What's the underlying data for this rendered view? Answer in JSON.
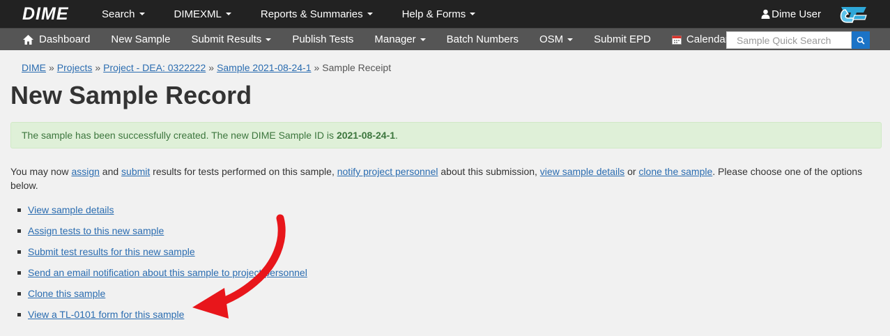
{
  "topbar": {
    "brand": "DIME",
    "nav": [
      {
        "label": "Search",
        "dropdown": true
      },
      {
        "label": "DIMEXML",
        "dropdown": true
      },
      {
        "label": "Reports & Summaries",
        "dropdown": true
      },
      {
        "label": "Help & Forms",
        "dropdown": true
      }
    ],
    "user": "Dime User"
  },
  "subbar": {
    "items": [
      {
        "label": "Dashboard",
        "icon": "home-icon"
      },
      {
        "label": "New Sample"
      },
      {
        "label": "Submit Results",
        "dropdown": true
      },
      {
        "label": "Publish Tests"
      },
      {
        "label": "Manager",
        "dropdown": true
      },
      {
        "label": "Batch Numbers"
      },
      {
        "label": "OSM",
        "dropdown": true
      },
      {
        "label": "Submit EPD"
      },
      {
        "label": "Calendar",
        "icon": "calendar-icon"
      }
    ],
    "search_placeholder": "Sample Quick Search"
  },
  "breadcrumb": {
    "items": [
      "DIME",
      "Projects",
      "Project - DEA: 0322222",
      "Sample 2021-08-24-1"
    ],
    "current": "Sample Receipt",
    "separator": "»"
  },
  "page_title": "New Sample Record",
  "alert": {
    "text": "The sample has been successfully created. The new DIME Sample ID is",
    "sample_id": "2021-08-24-1",
    "end": "."
  },
  "intro": {
    "t1": "You may now ",
    "l1": "assign",
    "t2": " and ",
    "l2": "submit",
    "t3": " results for tests performed on this sample, ",
    "l3": "notify project personnel",
    "t4": " about this submission, ",
    "l4": "view sample details",
    "t5": " or ",
    "l5": "clone the sample",
    "t6": ". Please choose one of the options below."
  },
  "options": [
    "View sample details",
    "Assign tests to this new sample",
    "Submit test results for this new sample",
    "Send an email notification about this sample to project personnel",
    "Clone this sample",
    "View a TL-0101 form for this sample"
  ],
  "colors": {
    "topbar": "#222222",
    "subbar": "#555555",
    "link": "#2a6cb0",
    "alert_bg": "#dff0d8",
    "alert_text": "#3c763d",
    "annotation_arrow": "#e8161b"
  }
}
